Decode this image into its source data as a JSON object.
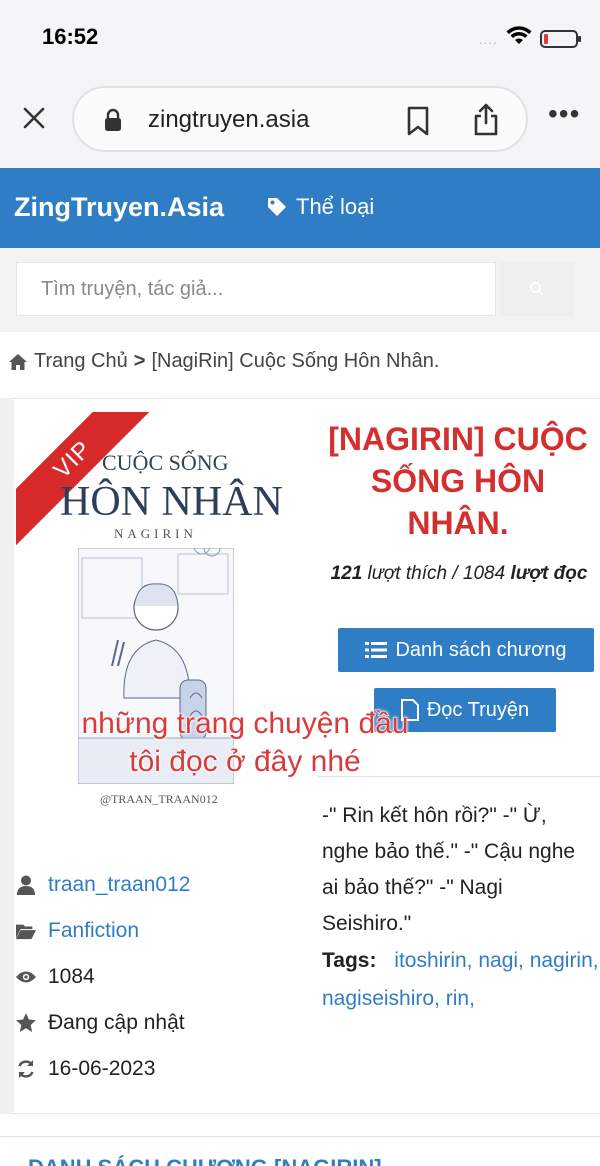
{
  "status_bar": {
    "time": "16:52",
    "signal": "....",
    "icons": [
      "wifi-icon",
      "battery-icon"
    ],
    "battery_level": 0.12
  },
  "browser": {
    "url": "zingtruyen.asia",
    "icons": [
      "close-icon",
      "lock-icon",
      "bookmark-icon",
      "share-icon",
      "more-icon"
    ],
    "more": "•••"
  },
  "header": {
    "logo": "ZingTruyen.Asia",
    "genre_label": "Thể loại",
    "color": "#2f7ec5"
  },
  "search": {
    "placeholder": "Tìm truyện, tác giả..."
  },
  "breadcrumb": {
    "home": "Trang Chủ",
    "separator": ">",
    "current": "[NagiRin] Cuộc Sống Hôn Nhân."
  },
  "story": {
    "cover": {
      "badge": "VIP",
      "title_line1": "CUỘC SỐNG",
      "title_line2": "HÔN NHÂN",
      "author_line": "NAGIRIN",
      "credit": "@TRAAN_TRAAN012"
    },
    "title": "[NAGIRIN] CUỘC SỐNG HÔN NHÂN.",
    "likes": "121",
    "likes_label": "lượt thích /",
    "reads": "1084",
    "reads_label": "lượt đọc",
    "chapter_list_button": "Danh sách chương",
    "read_button": "Đọc Truyện",
    "overlay_caption_line1": "những trang chuyện đầu",
    "overlay_caption_line2": "tôi đọc ở đây nhé",
    "description": "-\" Rin kết hôn rồi?\" -\" Ừ, nghe bảo thế.\" -\" Cậu nghe ai bảo thế?\" -\" Nagi Seishiro.\"",
    "tags_label": "Tags:",
    "tags": [
      "itoshirin,",
      "nagi,",
      "nagirin,",
      "nagiseishiro,",
      "rin,"
    ],
    "info": {
      "author": "traan_traan012",
      "category": "Fanfiction",
      "views": "1084",
      "status": "Đang cập nhật",
      "updated": "16-06-2023"
    }
  },
  "bottom_section": {
    "title": "DANH SÁCH CHƯƠNG [NAGIRIN]"
  }
}
